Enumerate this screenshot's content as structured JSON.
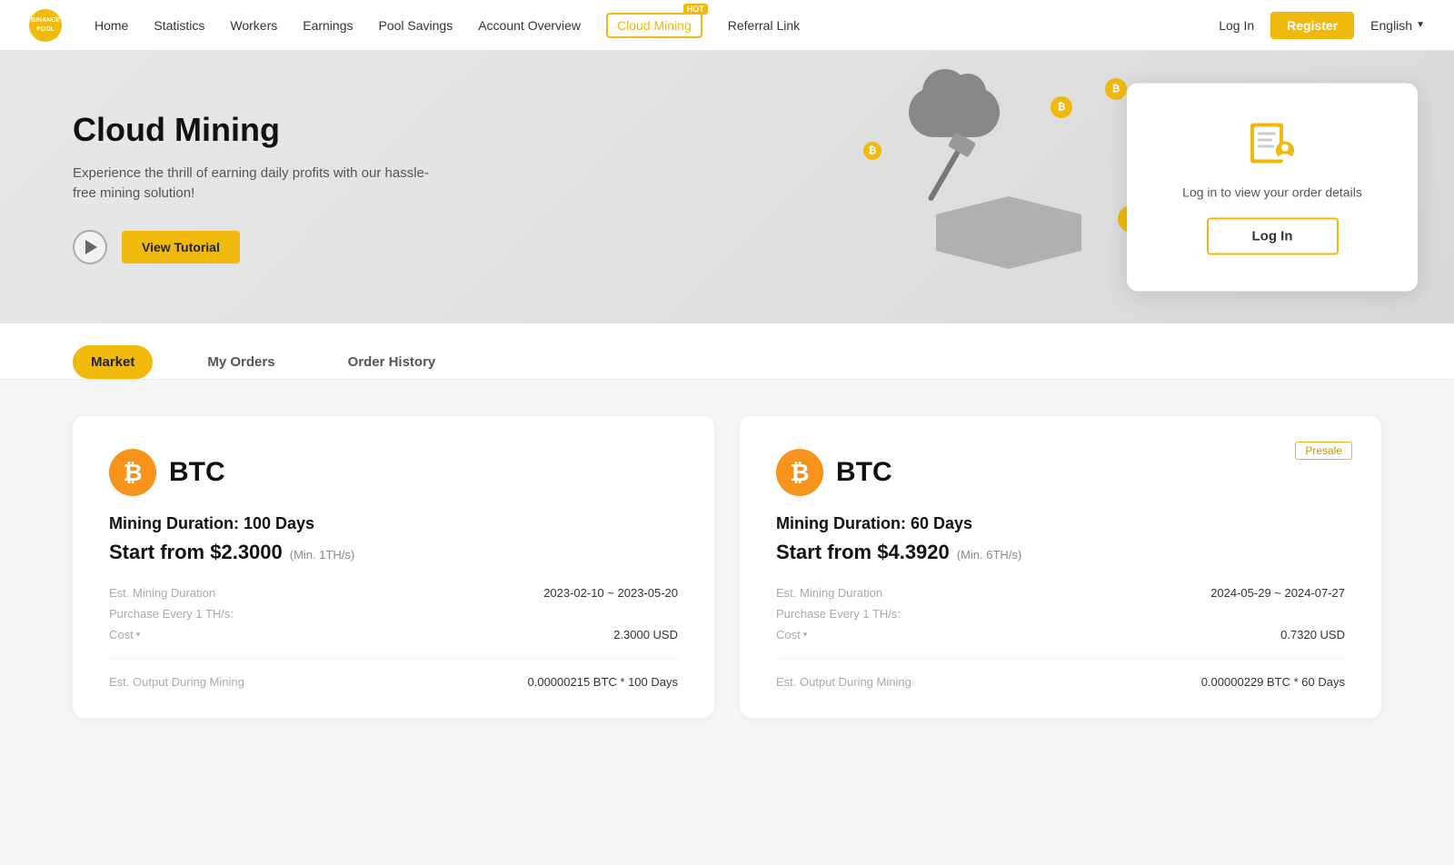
{
  "nav": {
    "logo_text": "BINANCE\nPOOL",
    "links": [
      {
        "label": "Home",
        "key": "home"
      },
      {
        "label": "Statistics",
        "key": "statistics"
      },
      {
        "label": "Workers",
        "key": "workers"
      },
      {
        "label": "Earnings",
        "key": "earnings"
      },
      {
        "label": "Pool Savings",
        "key": "pool-savings"
      },
      {
        "label": "Account Overview",
        "key": "account-overview"
      },
      {
        "label": "Cloud Mining",
        "key": "cloud-mining",
        "hot": true,
        "active": true
      },
      {
        "label": "Referral Link",
        "key": "referral-link"
      }
    ],
    "login_label": "Log In",
    "register_label": "Register",
    "language": "English",
    "hot_label": "HOT"
  },
  "hero": {
    "title": "Cloud Mining",
    "description": "Experience the thrill of earning daily profits with our hassle-free mining solution!",
    "tutorial_label": "View Tutorial",
    "order_card": {
      "login_text": "Log in to view your order details",
      "login_btn": "Log In"
    }
  },
  "tabs": [
    {
      "label": "Market",
      "key": "market",
      "active": true
    },
    {
      "label": "My Orders",
      "key": "my-orders",
      "active": false
    },
    {
      "label": "Order History",
      "key": "order-history",
      "active": false
    }
  ],
  "cards": [
    {
      "coin": "BTC",
      "presale": false,
      "duration_label": "Mining Duration: 100 Days",
      "price": "Start from $2.3000",
      "min": "(Min. 1TH/s)",
      "details": [
        {
          "label": "Est. Mining Duration",
          "value": "2023-02-10 ~ 2023-05-20"
        },
        {
          "label": "Purchase Every 1 TH/s:",
          "value": ""
        },
        {
          "label": "Cost",
          "is_dropdown": true,
          "value": "2.3000 USD"
        },
        {
          "label": "Est. Output During Mining",
          "value": "0.00000215 BTC * 100 Days"
        }
      ]
    },
    {
      "coin": "BTC",
      "presale": true,
      "presale_label": "Presale",
      "duration_label": "Mining Duration: 60 Days",
      "price": "Start from $4.3920",
      "min": "(Min. 6TH/s)",
      "details": [
        {
          "label": "Est. Mining Duration",
          "value": "2024-05-29 ~ 2024-07-27"
        },
        {
          "label": "Purchase Every 1 TH/s:",
          "value": ""
        },
        {
          "label": "Cost",
          "is_dropdown": true,
          "value": "0.7320 USD"
        },
        {
          "label": "Est. Output During Mining",
          "value": "0.00000229 BTC * 60 Days"
        }
      ]
    }
  ]
}
